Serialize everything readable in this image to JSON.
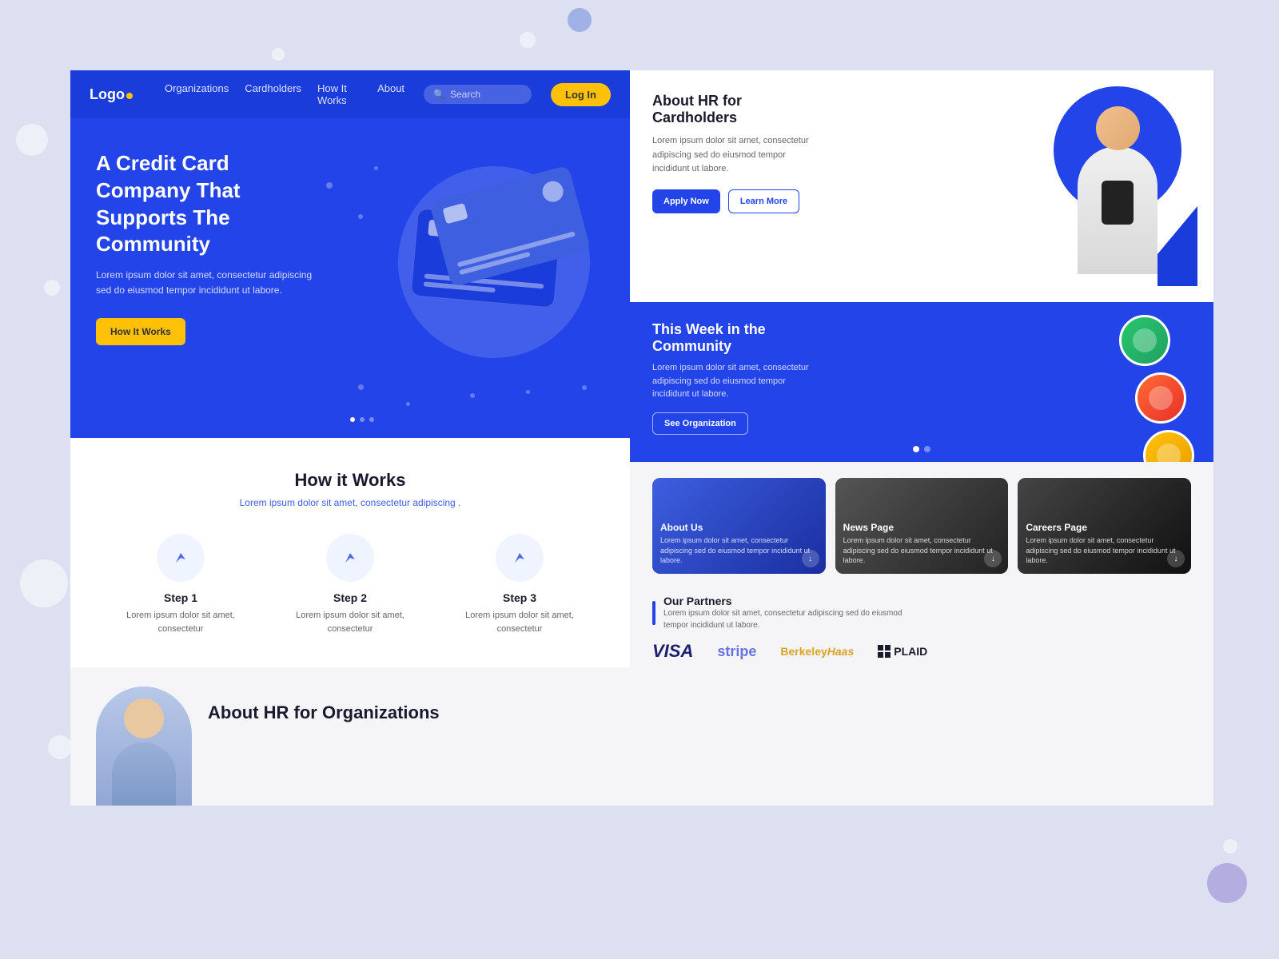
{
  "page": {
    "bg_color": "#dde0f0"
  },
  "navbar": {
    "logo": "Logo",
    "links": [
      "Organizations",
      "Cardholders",
      "How It Works",
      "About"
    ],
    "search_placeholder": "Search",
    "login_label": "Log In"
  },
  "hero": {
    "title": "A Credit Card Company That Supports The Community",
    "subtitle": "Lorem ipsum dolor sit amet, consectetur adipiscing sed do  eiusmod tempor incididunt ut labore.",
    "cta_label": "How It Works"
  },
  "how_it_works": {
    "title": "How it Works",
    "subtitle": "Lorem ipsum dolor sit amet, consectetur adipiscing .",
    "steps": [
      {
        "name": "Step 1",
        "desc": "Lorem ipsum dolor sit amet, consectetur"
      },
      {
        "name": "Step 2",
        "desc": "Lorem ipsum dolor sit amet, consectetur"
      },
      {
        "name": "Step 3",
        "desc": "Lorem ipsum dolor sit amet, consectetur"
      }
    ]
  },
  "left_bottom": {
    "title": "About HR for Organizations"
  },
  "right_top": {
    "title": "About HR for Cardholders",
    "body": "Lorem ipsum dolor sit amet, consectetur adipiscing sed do  eiusmod tempor incididunt ut labore.",
    "apply_label": "Apply Now",
    "learn_label": "Learn More"
  },
  "right_mid": {
    "title": "This Week in the Community",
    "body": "Lorem ipsum dolor sit amet, consectetur adipiscing sed do  eiusmod tempor incididunt ut labore.",
    "cta_label": "See Organization"
  },
  "info_cards": [
    {
      "title": "About Us",
      "body": "Lorem ipsum dolor sit amet, consectetur adipiscing sed do  eiusmod tempor incididunt ut labore."
    },
    {
      "title": "News Page",
      "body": "Lorem ipsum dolor sit amet, consectetur adipiscing sed do  eiusmod tempor incididunt ut labore."
    },
    {
      "title": "Careers Page",
      "body": "Lorem ipsum dolor sit amet, consectetur adipiscing sed do  eiusmod tempor incididunt ut labore."
    }
  ],
  "partners": {
    "title": "Our Partners",
    "subtitle": "Lorem ipsum dolor sit amet, consectetur adipiscing sed do  eiusmod tempor incididunt ut labore.",
    "logos": [
      "VISA",
      "stripe",
      "BerkeleyHaas",
      "PLAID"
    ]
  }
}
